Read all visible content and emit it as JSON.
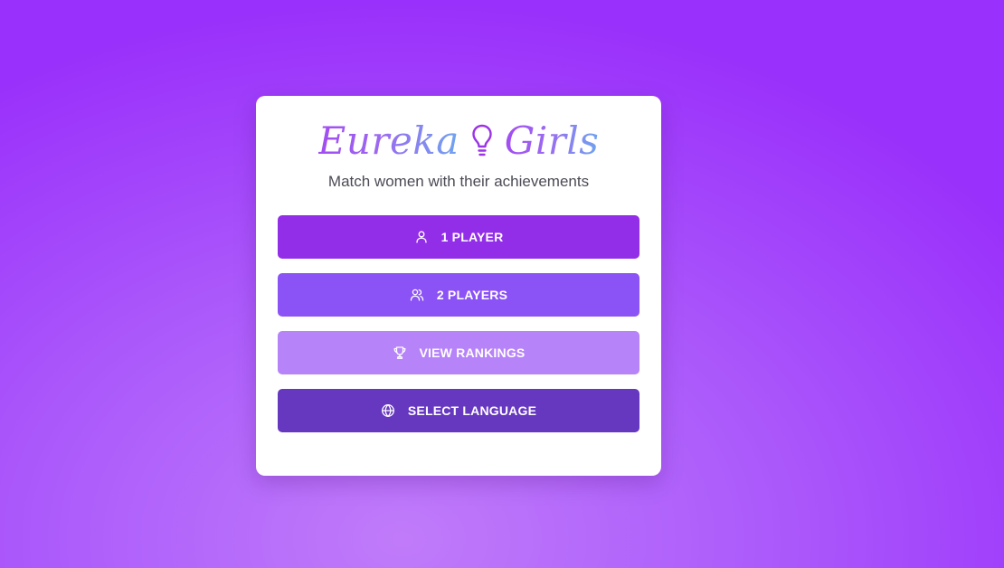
{
  "app": {
    "title_left": "Eureka",
    "title_right": "Girls",
    "title_icon": "lightbulb-icon",
    "subtitle": "Match women with their achievements"
  },
  "menu": {
    "buttons": [
      {
        "label": "1 PLAYER",
        "icon": "user-icon",
        "color": "#922de8"
      },
      {
        "label": "2 PLAYERS",
        "icon": "users-icon",
        "color": "#8b52f6"
      },
      {
        "label": "VIEW RANKINGS",
        "icon": "trophy-icon",
        "color": "#b683f8"
      },
      {
        "label": "SELECT LANGUAGE",
        "icon": "globe-icon",
        "color": "#6637bf"
      }
    ]
  },
  "colors": {
    "background_center": "#c07bfa",
    "background_edge": "#9a30fb",
    "title_gradient_start": "#a24cf2",
    "title_gradient_end": "#6fa4f0"
  }
}
